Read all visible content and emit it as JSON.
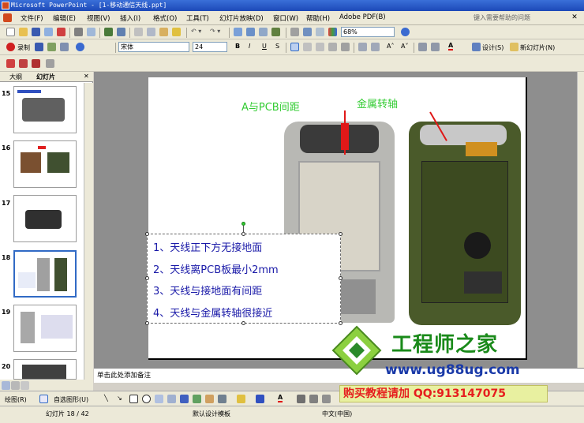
{
  "window": {
    "title": "Microsoft PowerPoint - [1-移动通信天线.ppt]"
  },
  "menu": {
    "items": [
      "文件(F)",
      "编辑(E)",
      "视图(V)",
      "插入(I)",
      "格式(O)",
      "工具(T)",
      "幻灯片放映(D)",
      "窗口(W)",
      "帮助(H)",
      "Adobe PDF(B)"
    ],
    "help_placeholder": "键入需要帮助的问题"
  },
  "toolbar": {
    "zoom": "68%",
    "record": "录制",
    "font_name": "宋体",
    "font_size": "24",
    "bold": "B",
    "italic": "I",
    "underline": "U",
    "shadow": "S",
    "design": "设计(S)",
    "new_slide": "新幻灯片(N)"
  },
  "sidebar": {
    "tabs": [
      "大纲",
      "幻灯片"
    ],
    "slide_numbers": [
      "15",
      "16",
      "17",
      "18",
      "19",
      "20"
    ],
    "selected": "18"
  },
  "slide": {
    "captions": {
      "gap": "A与PCB间距",
      "hinge": "金属转轴"
    },
    "bullets": [
      "1、天线正下方无接地面",
      "2、天线离PCB板最小2mm",
      "3、天线与接地面有间距",
      "4、天线与金属转轴很接近"
    ]
  },
  "notes": {
    "placeholder": "单击此处添加备注"
  },
  "drawbar": {
    "draw": "绘图(R)",
    "autoshapes": "自选图形(U)"
  },
  "status": {
    "slide": "幻灯片 18 / 42",
    "template": "默认设计模板",
    "language": "中文(中国)"
  },
  "watermark": {
    "title": "工程师之家",
    "url": "www.ug88ug.com",
    "banner": "购买教程请加 QQ:913147075"
  }
}
